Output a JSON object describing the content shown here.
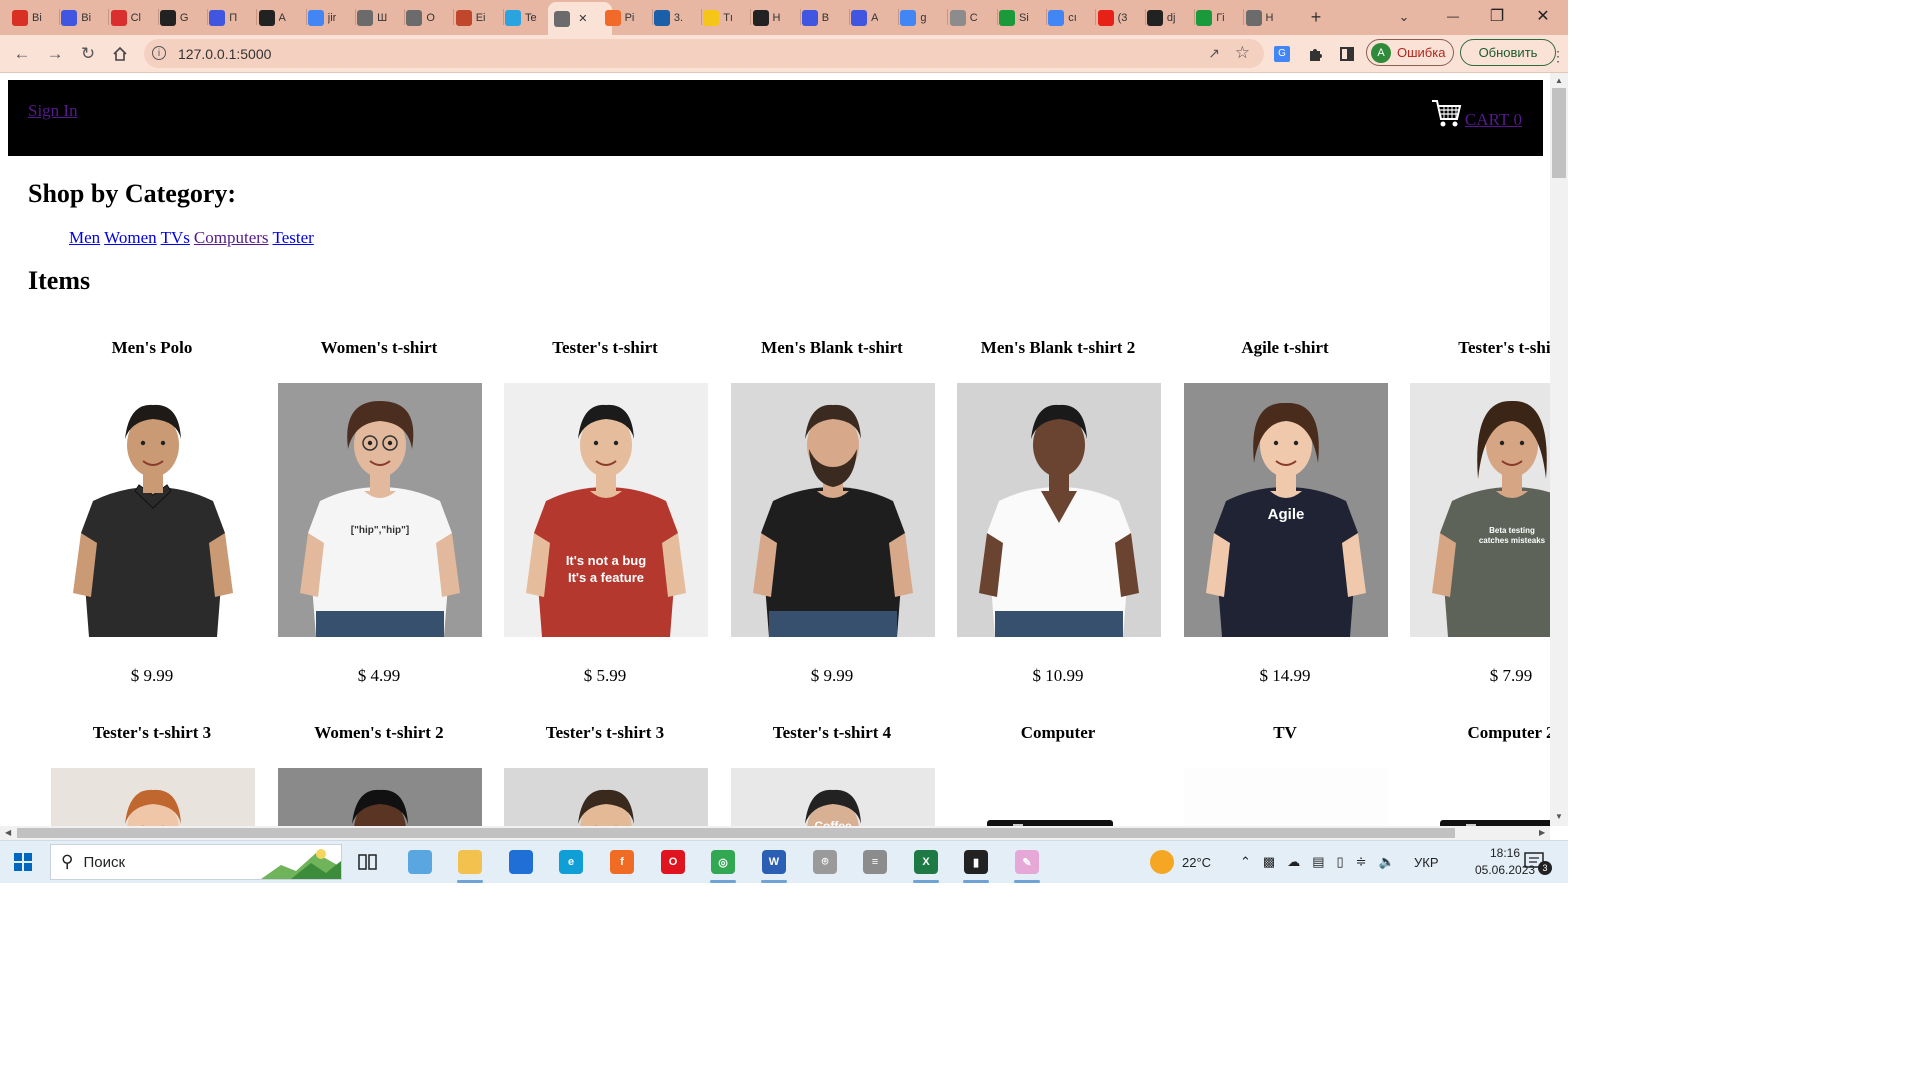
{
  "browser": {
    "tabs": [
      {
        "title": "Bi",
        "icon": "gmail-icon",
        "color": "#d93025"
      },
      {
        "title": "Bi",
        "icon": "django-icon",
        "color": "#4056e0"
      },
      {
        "title": "Cl",
        "icon": "heart-icon",
        "color": "#d92f2f"
      },
      {
        "title": "G",
        "icon": "github-icon",
        "color": "#222222"
      },
      {
        "title": "П",
        "icon": "django-icon",
        "color": "#4056e0"
      },
      {
        "title": "A",
        "icon": "github-icon",
        "color": "#222222"
      },
      {
        "title": "jir",
        "icon": "google-icon",
        "color": "#4285f4"
      },
      {
        "title": "Ш",
        "icon": "globe-icon",
        "color": "#6b6b6b"
      },
      {
        "title": "О",
        "icon": "globe-icon",
        "color": "#6b6b6b"
      },
      {
        "title": "Ei",
        "icon": "q-icon",
        "color": "#c0472b"
      },
      {
        "title": "Te",
        "icon": "telegram-icon",
        "color": "#2aa3df"
      },
      {
        "title": "",
        "icon": "globe-icon",
        "color": "#6b6b6b",
        "active": true
      },
      {
        "title": "Pi",
        "icon": "pse-icon",
        "color": "#f26a2a"
      },
      {
        "title": "3.",
        "icon": "s-icon",
        "color": "#1b5fa8"
      },
      {
        "title": "Tı",
        "icon": "bulb-icon",
        "color": "#f5c518"
      },
      {
        "title": "H",
        "icon": "qa-icon",
        "color": "#222222"
      },
      {
        "title": "B",
        "icon": "django-icon",
        "color": "#4056e0"
      },
      {
        "title": "A",
        "icon": "django-icon",
        "color": "#4056e0"
      },
      {
        "title": "g",
        "icon": "google-icon",
        "color": "#4285f4"
      },
      {
        "title": "C",
        "icon": "dolphin-icon",
        "color": "#8c8c8c"
      },
      {
        "title": "Si",
        "icon": "w-icon",
        "color": "#1a9a3a"
      },
      {
        "title": "cı",
        "icon": "google-icon",
        "color": "#4285f4"
      },
      {
        "title": "(3",
        "icon": "youtube-icon",
        "color": "#e62117"
      },
      {
        "title": "dj",
        "icon": "github-icon",
        "color": "#222222"
      },
      {
        "title": "Гі",
        "icon": "w-icon",
        "color": "#1a9a3a"
      },
      {
        "title": "H",
        "icon": "chrome-ext-icon",
        "color": "#6b6b6b"
      }
    ],
    "url": "127.0.0.1:5000",
    "profile_initial": "A",
    "profile_label": "Ошибка",
    "update_label": "Обновить"
  },
  "site": {
    "sign_in": "Sign In",
    "cart_label": "CART",
    "cart_count": "0",
    "category_heading": "Shop by Category:",
    "categories": [
      {
        "label": "Men",
        "visited": false
      },
      {
        "label": "Women",
        "visited": false
      },
      {
        "label": "TVs",
        "visited": false
      },
      {
        "label": "Computers",
        "visited": true
      },
      {
        "label": "Tester",
        "visited": false
      }
    ],
    "items_heading": "Items",
    "row1": [
      {
        "name": "Men's Polo",
        "price": "$ 9.99",
        "image": "man-black-polo"
      },
      {
        "name": "Women's t-shirt",
        "price": "$ 4.99",
        "image": "woman-white-tshirt",
        "shirt_text": "[\"hip\",\"hip\"]"
      },
      {
        "name": "Tester's t-shirt",
        "price": "$ 5.99",
        "image": "man-red-tshirt",
        "shirt_text": "It's not a bug It's a feature"
      },
      {
        "name": "Men's Blank t-shirt",
        "price": "$ 9.99",
        "image": "bearded-man-black-tshirt"
      },
      {
        "name": "Men's Blank t-shirt 2",
        "price": "$ 10.99",
        "image": "man-white-vneck"
      },
      {
        "name": "Agile t-shirt",
        "price": "$ 14.99",
        "image": "girl-navy-tshirt",
        "shirt_text": "Agile"
      },
      {
        "name": "Tester's t-shirt",
        "price": "$ 7.99",
        "image": "woman-olive-tshirt",
        "shirt_text": "Beta testing catches misteaks"
      }
    ],
    "row2": [
      {
        "name": "Tester's t-shirt 3",
        "image": "woman-grey-tshirt"
      },
      {
        "name": "Women's t-shirt 2",
        "image": "woman-dark-hair"
      },
      {
        "name": "Tester's t-shirt 3",
        "image": "smiling-man"
      },
      {
        "name": "Tester's t-shirt 4",
        "image": "black-tshirt",
        "shirt_text": "Coffee"
      },
      {
        "name": "Computer",
        "image": "laptop"
      },
      {
        "name": "TV",
        "image": "tv"
      },
      {
        "name": "Computer 2",
        "image": "laptop"
      }
    ]
  },
  "taskbar": {
    "search_placeholder": "Поиск",
    "apps": [
      "file-explorer-icon",
      "store-icon",
      "edge-icon",
      "firefox-icon",
      "opera-icon",
      "chrome-icon",
      "word-icon",
      "network-icon",
      "database-icon",
      "excel-icon",
      "terminal-icon",
      "paint-icon"
    ],
    "weather_temp": "22°C",
    "language": "УКР",
    "time": "18:16",
    "date": "05.06.2023",
    "notification_count": "3"
  }
}
